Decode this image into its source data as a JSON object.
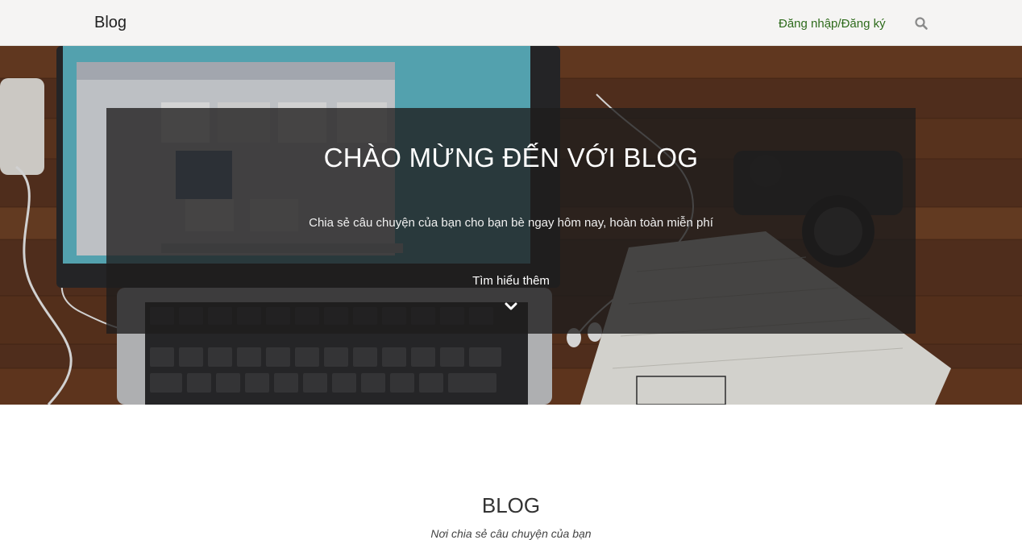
{
  "navbar": {
    "brand": "Blog",
    "login_link": "Đăng nhập/Đăng ký",
    "search_icon": "search-icon"
  },
  "hero": {
    "title": "CHÀO MỪNG ĐẾN VỚI BLOG",
    "subtitle": "Chia sẻ câu chuyện của bạn cho bạn bè ngay hôm nay, hoàn toàn miễn phí",
    "learn_more": "Tìm hiểu thêm",
    "chevron_icon": "chevron-down-icon"
  },
  "section": {
    "title": "BLOG",
    "subtitle": "Nơi chia sẻ câu chuyện của bạn"
  },
  "colors": {
    "navbar_bg": "#f5f4f3",
    "login_link": "#2e6b1c",
    "hero_overlay": "rgba(30,28,28,0.78)"
  }
}
